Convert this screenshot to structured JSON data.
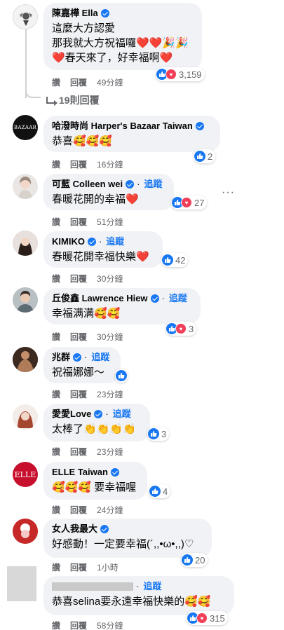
{
  "comments": [
    {
      "name": "陳嘉樺 Ella",
      "verified": true,
      "follow": "",
      "lines": [
        "這麼大方認愛",
        "那我就大方祝福囉❤️❤️🎉🎉",
        "❤️春天來了，好幸福啊❤️"
      ],
      "reactions": "3,159",
      "love": true,
      "actions": [
        "讚",
        "回覆",
        "49分鐘"
      ]
    },
    {
      "name": "哈潑時尚 Harper's Bazaar Taiwan",
      "verified": true,
      "follow": "",
      "lines": [
        "恭喜🥰🥰🥰"
      ],
      "reactions": "2",
      "love": false,
      "actions": [
        "讚",
        "回覆",
        "16分鐘"
      ]
    },
    {
      "name": "可藍 Colleen wei",
      "verified": true,
      "follow": "追蹤",
      "lines": [
        "春暖花開的幸福❤️"
      ],
      "reactions": "27",
      "love": true,
      "actions": [
        "讚",
        "回覆",
        "51分鐘"
      ]
    },
    {
      "name": "KIMIKO",
      "verified": true,
      "follow": "追蹤",
      "lines": [
        "春暖花開幸福快樂❤️"
      ],
      "reactions": "42",
      "love": false,
      "actions": [
        "讚",
        "回覆",
        "30分鐘"
      ]
    },
    {
      "name": "丘俊鑫 Lawrence Hiew",
      "verified": true,
      "follow": "追蹤",
      "lines": [
        "幸福满满🥰🥰"
      ],
      "reactions": "3",
      "love": true,
      "actions": [
        "讚",
        "回覆",
        "30分鐘"
      ]
    },
    {
      "name": "兆群",
      "verified": true,
      "follow": "追蹤",
      "lines": [
        "祝福娜娜～"
      ],
      "reactions": "",
      "love": false,
      "actions": [
        "讚",
        "回覆",
        "23分鐘"
      ]
    },
    {
      "name": "愛愛Love",
      "verified": true,
      "follow": "追蹤",
      "lines": [
        "太棒了👏👏👏👏"
      ],
      "reactions": "3",
      "love": false,
      "actions": [
        "讚",
        "回覆",
        "23分鐘"
      ]
    },
    {
      "name": "ELLE Taiwan",
      "verified": true,
      "follow": "",
      "lines": [
        "🥰🥰🥰 要幸福喔"
      ],
      "reactions": "4",
      "love": false,
      "actions": [
        "讚",
        "回覆",
        "24分鐘"
      ]
    },
    {
      "name": "女人我最大",
      "verified": true,
      "follow": "",
      "lines": [
        "好感動！一定要幸福(´,,•ω•,,)♡"
      ],
      "reactions": "20",
      "love": false,
      "actions": [
        "讚",
        "回覆",
        "1小時"
      ]
    },
    {
      "name": "",
      "verified": false,
      "follow": "追蹤",
      "lines": [
        "恭喜selina要永遠幸福快樂的🥰🥰"
      ],
      "reactions": "315",
      "love": true,
      "actions": [
        "讚",
        "回覆",
        "58分鐘"
      ]
    }
  ],
  "replies_link": "19則回覆",
  "more_label": "···",
  "avatar_texts": {
    "bazaar": "BAZAAR",
    "elle": "ELLE"
  },
  "colors": {
    "accent": "#1877f2",
    "bubble": "#f0f2f5",
    "love": "#f33e58"
  }
}
